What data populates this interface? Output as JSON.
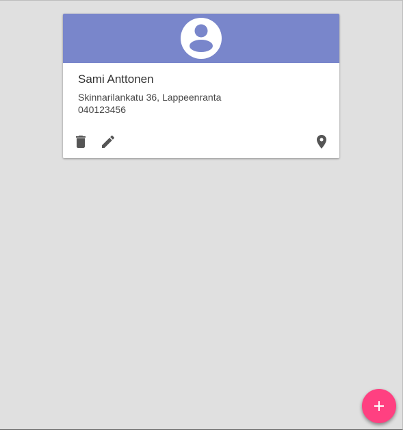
{
  "theme": {
    "page_background": "#e0e0e0",
    "card_header_color": "#7986cb",
    "icon_color": "#555555",
    "fab_color": "#ff4081"
  },
  "contact": {
    "name": "Sami Anttonen",
    "address": "Skinnarilankatu 36, Lappeenranta",
    "phone": "040123456",
    "avatar_icon": "account-circle-icon"
  },
  "card_actions": [
    {
      "id": "delete",
      "icon": "trash-icon"
    },
    {
      "id": "edit",
      "icon": "pencil-icon"
    },
    {
      "id": "map",
      "icon": "map-pin-icon"
    }
  ],
  "fab": {
    "label": "+",
    "icon": "plus-icon"
  }
}
